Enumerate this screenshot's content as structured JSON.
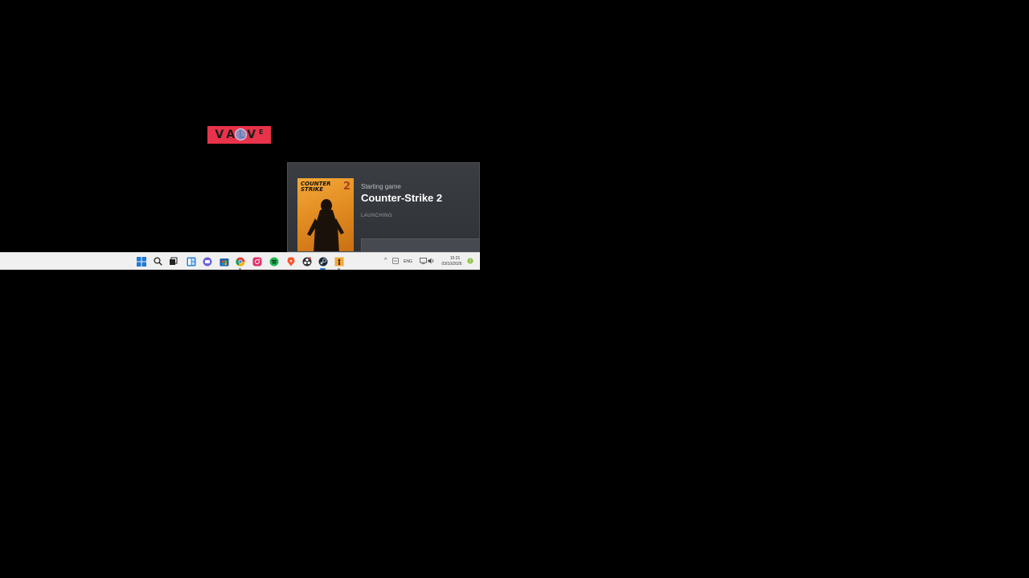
{
  "splash": {
    "logo_main": "VALV",
    "logo_sup": "E"
  },
  "launch_popup": {
    "subtitle": "Starting game",
    "game_title": "Counter-Strike 2",
    "status": "LAUNCHING",
    "cover": {
      "title": "COUNTER STRIKE",
      "number": "2",
      "accent_color": "#f3a83a"
    }
  },
  "taskbar": {
    "pinned_apps": [
      {
        "name": "start-icon"
      },
      {
        "name": "search-icon"
      },
      {
        "name": "task-view-icon"
      },
      {
        "name": "widgets-icon"
      },
      {
        "name": "chat-icon"
      },
      {
        "name": "microsoft-store-icon"
      },
      {
        "name": "chrome-icon"
      },
      {
        "name": "instagram-icon"
      },
      {
        "name": "spotify-icon"
      },
      {
        "name": "brave-icon"
      },
      {
        "name": "obs-icon"
      },
      {
        "name": "steam-icon"
      },
      {
        "name": "counter-strike-2-icon"
      }
    ],
    "tray": {
      "language": "ENG",
      "time": "15:21",
      "date": "03/10/2026"
    }
  },
  "colors": {
    "valve_red": "#e8334a",
    "popup_bg": "#3a3d42",
    "taskbar_bg": "#f0f0f0",
    "active_indicator": "#2a7fd4"
  }
}
